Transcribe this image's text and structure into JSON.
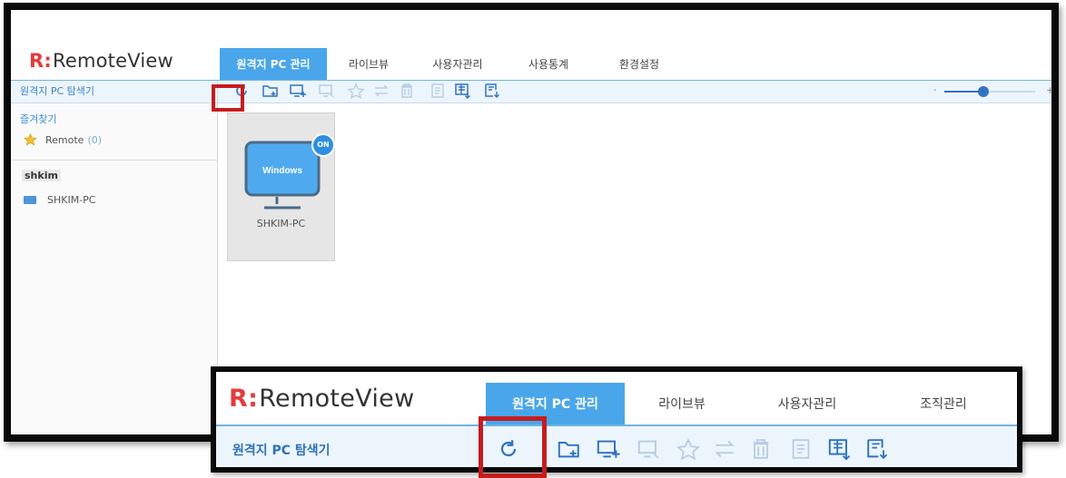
{
  "app": {
    "logo_r": "R",
    "logo_colon": ":",
    "logo_text": "RemoteView"
  },
  "tabs": [
    {
      "label": "원격지 PC 관리",
      "active": true
    },
    {
      "label": "라이브뷰"
    },
    {
      "label": "사용자관리"
    },
    {
      "label": "사용통계"
    },
    {
      "label": "환경설정"
    }
  ],
  "sidebar": {
    "title": "원격지 PC 탐색기",
    "favorites_header": "즐겨찾기",
    "favorite_item": {
      "label": "Remote",
      "count": "(0)"
    },
    "user": "shkim",
    "pc_item": "SHKIM-PC"
  },
  "toolbar": {
    "icons": [
      "refresh-icon",
      "add-group-icon",
      "add-pc-icon",
      "move-pc-icon",
      "favorite-icon",
      "swap-icon",
      "delete-icon",
      "memo-icon",
      "export-list-icon",
      "import-list-icon"
    ],
    "zoom_minus": "-",
    "zoom_plus": "+",
    "zoom_level": 0.43
  },
  "tile": {
    "os_label": "Windows",
    "status_badge": "ON",
    "name": "SHKIM-PC"
  },
  "zoomed": {
    "tabs": [
      {
        "label": "원격지 PC 관리",
        "active": true
      },
      {
        "label": "라이브뷰"
      },
      {
        "label": "사용자관리"
      },
      {
        "label": "조직관리"
      }
    ],
    "toolbar_title": "원격지 PC 탐색기"
  },
  "colors": {
    "accent": "#49a6ea",
    "logo_red": "#e33c3c",
    "highlight": "#c51c1c",
    "icon_blue": "#2f73c2"
  }
}
